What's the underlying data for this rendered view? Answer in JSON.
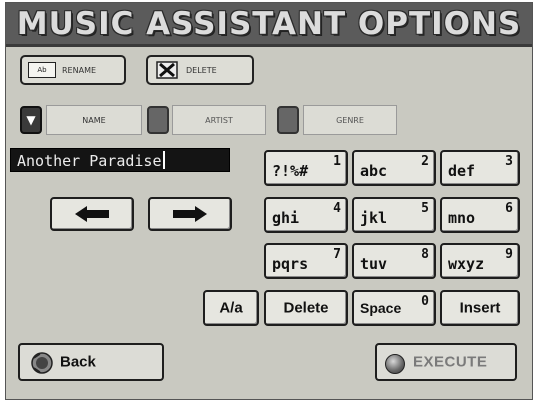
{
  "title": "MUSIC ASSISTANT OPTIONS",
  "toolbar": {
    "rename_label": "RENAME",
    "rename_icon_text": "Ab",
    "delete_label": "DELETE"
  },
  "filters": {
    "name": "NAME",
    "artist": "ARTIST",
    "genre": "GENRE"
  },
  "name_value": "Another Paradise",
  "keys": [
    {
      "letters": "?!%#",
      "number": "1"
    },
    {
      "letters": "abc",
      "number": "2"
    },
    {
      "letters": "def",
      "number": "3"
    },
    {
      "letters": "ghi",
      "number": "4"
    },
    {
      "letters": "jkl",
      "number": "5"
    },
    {
      "letters": "mno",
      "number": "6"
    },
    {
      "letters": "pqrs",
      "number": "7"
    },
    {
      "letters": "tuv",
      "number": "8"
    },
    {
      "letters": "wxyz",
      "number": "9"
    }
  ],
  "case_label": "A/a",
  "delete_key_label": "Delete",
  "space_key": {
    "label": "Space",
    "number": "0"
  },
  "insert_label": "Insert",
  "back_label": "Back",
  "execute_label": "EXECUTE"
}
